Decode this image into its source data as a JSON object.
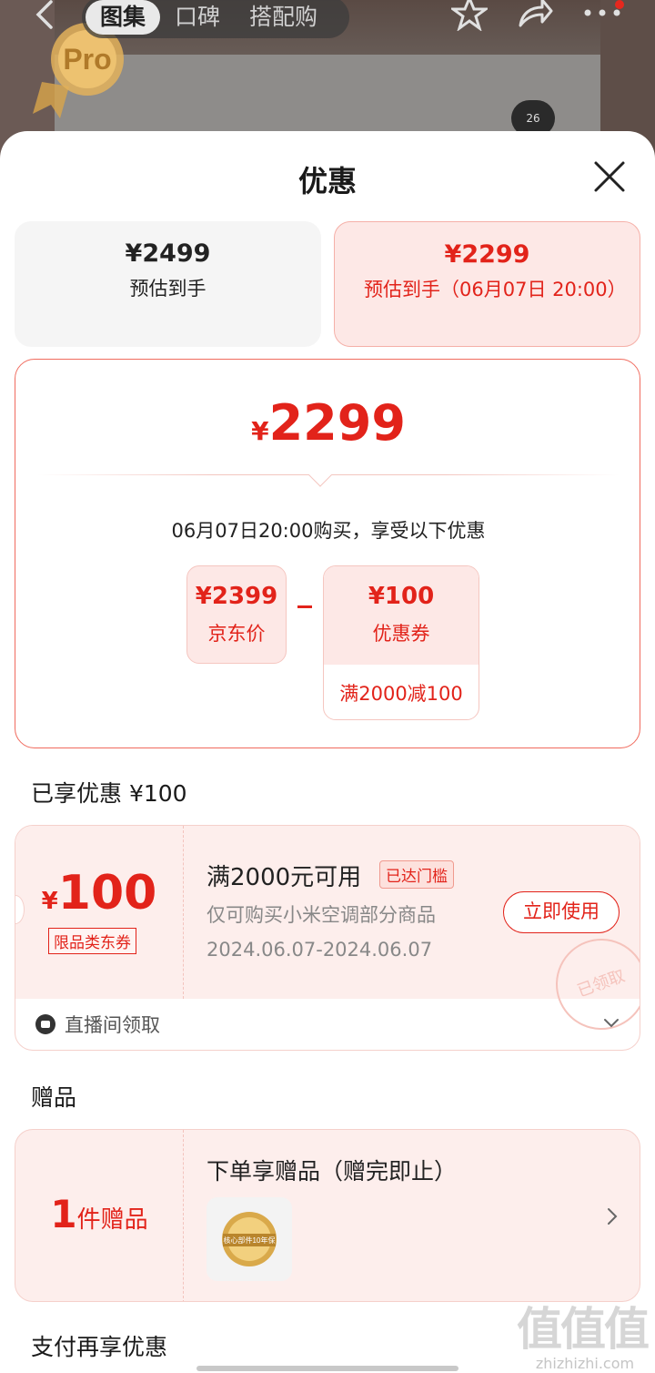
{
  "nav": {
    "tabs": [
      "图集",
      "口碑",
      "搭配购"
    ],
    "active_tab": "图集"
  },
  "background": {
    "badge_text": "Pro",
    "thermostat_reading": "26"
  },
  "sheet": {
    "title": "优惠",
    "price_options": [
      {
        "amount": "¥2499",
        "label": "预估到手"
      },
      {
        "amount": "¥2299",
        "label": "预估到手（06月07日 20:00）"
      }
    ],
    "detail": {
      "currency": "¥",
      "final_price": "2299",
      "note": "06月07日20:00购买，享受以下优惠",
      "jd_price": {
        "value": "¥2399",
        "label": "京东价"
      },
      "operator": "-",
      "coupon_box": {
        "value": "¥100",
        "label": "优惠券",
        "rule": "满2000减100"
      }
    },
    "enjoyed_header": "已享优惠 ¥100",
    "coupon": {
      "currency": "¥",
      "amount": "100",
      "tag": "限品类东券",
      "condition": "满2000元可用",
      "reached_badge": "已达门槛",
      "scope": "仅可购买小米空调部分商品",
      "dates": "2024.06.07-2024.06.07",
      "use_button": "立即使用",
      "stamp": "已领取",
      "source": "直播间领取"
    },
    "gifts_header": "赠品",
    "gift": {
      "count": "1",
      "unit": "件赠品",
      "title": "下单享赠品（赠完即止）",
      "thumb_text": "核心部件10年保"
    },
    "payment_header": "支付再享优惠"
  },
  "watermark": {
    "glyphs": "值值值",
    "site": "zhizhizhi.com"
  }
}
